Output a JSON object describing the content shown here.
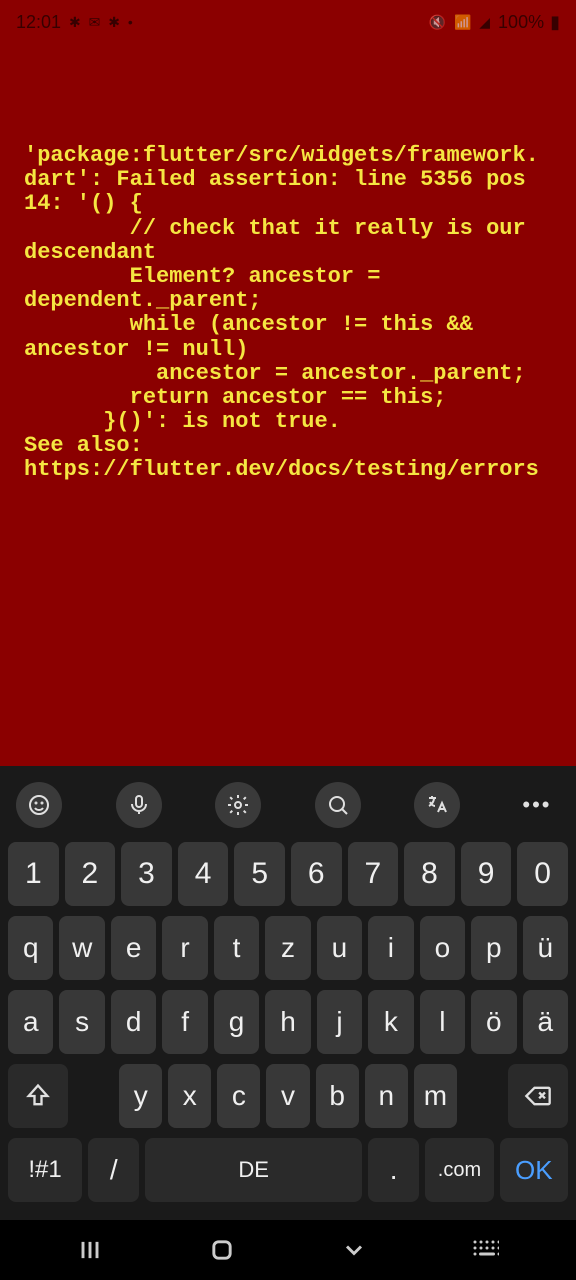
{
  "status": {
    "time": "12:01",
    "battery": "100%"
  },
  "error": {
    "text": "'package:flutter/src/widgets/framework.dart': Failed assertion: line 5356 pos 14: '() {\n        // check that it really is our descendant\n        Element? ancestor = dependent._parent;\n        while (ancestor != this && ancestor != null)\n          ancestor = ancestor._parent;\n        return ancestor == this;\n      }()': is not true.\nSee also: https://flutter.dev/docs/testing/errors"
  },
  "keyboard": {
    "row1": [
      "1",
      "2",
      "3",
      "4",
      "5",
      "6",
      "7",
      "8",
      "9",
      "0"
    ],
    "row2": [
      "q",
      "w",
      "e",
      "r",
      "t",
      "z",
      "u",
      "i",
      "o",
      "p",
      "ü"
    ],
    "row3": [
      "a",
      "s",
      "d",
      "f",
      "g",
      "h",
      "j",
      "k",
      "l",
      "ö",
      "ä"
    ],
    "row4": [
      "y",
      "x",
      "c",
      "v",
      "b",
      "n",
      "m"
    ],
    "symbols": "!#1",
    "slash": "/",
    "space": "DE",
    "dot": ".",
    "com": ".com",
    "ok": "OK"
  }
}
